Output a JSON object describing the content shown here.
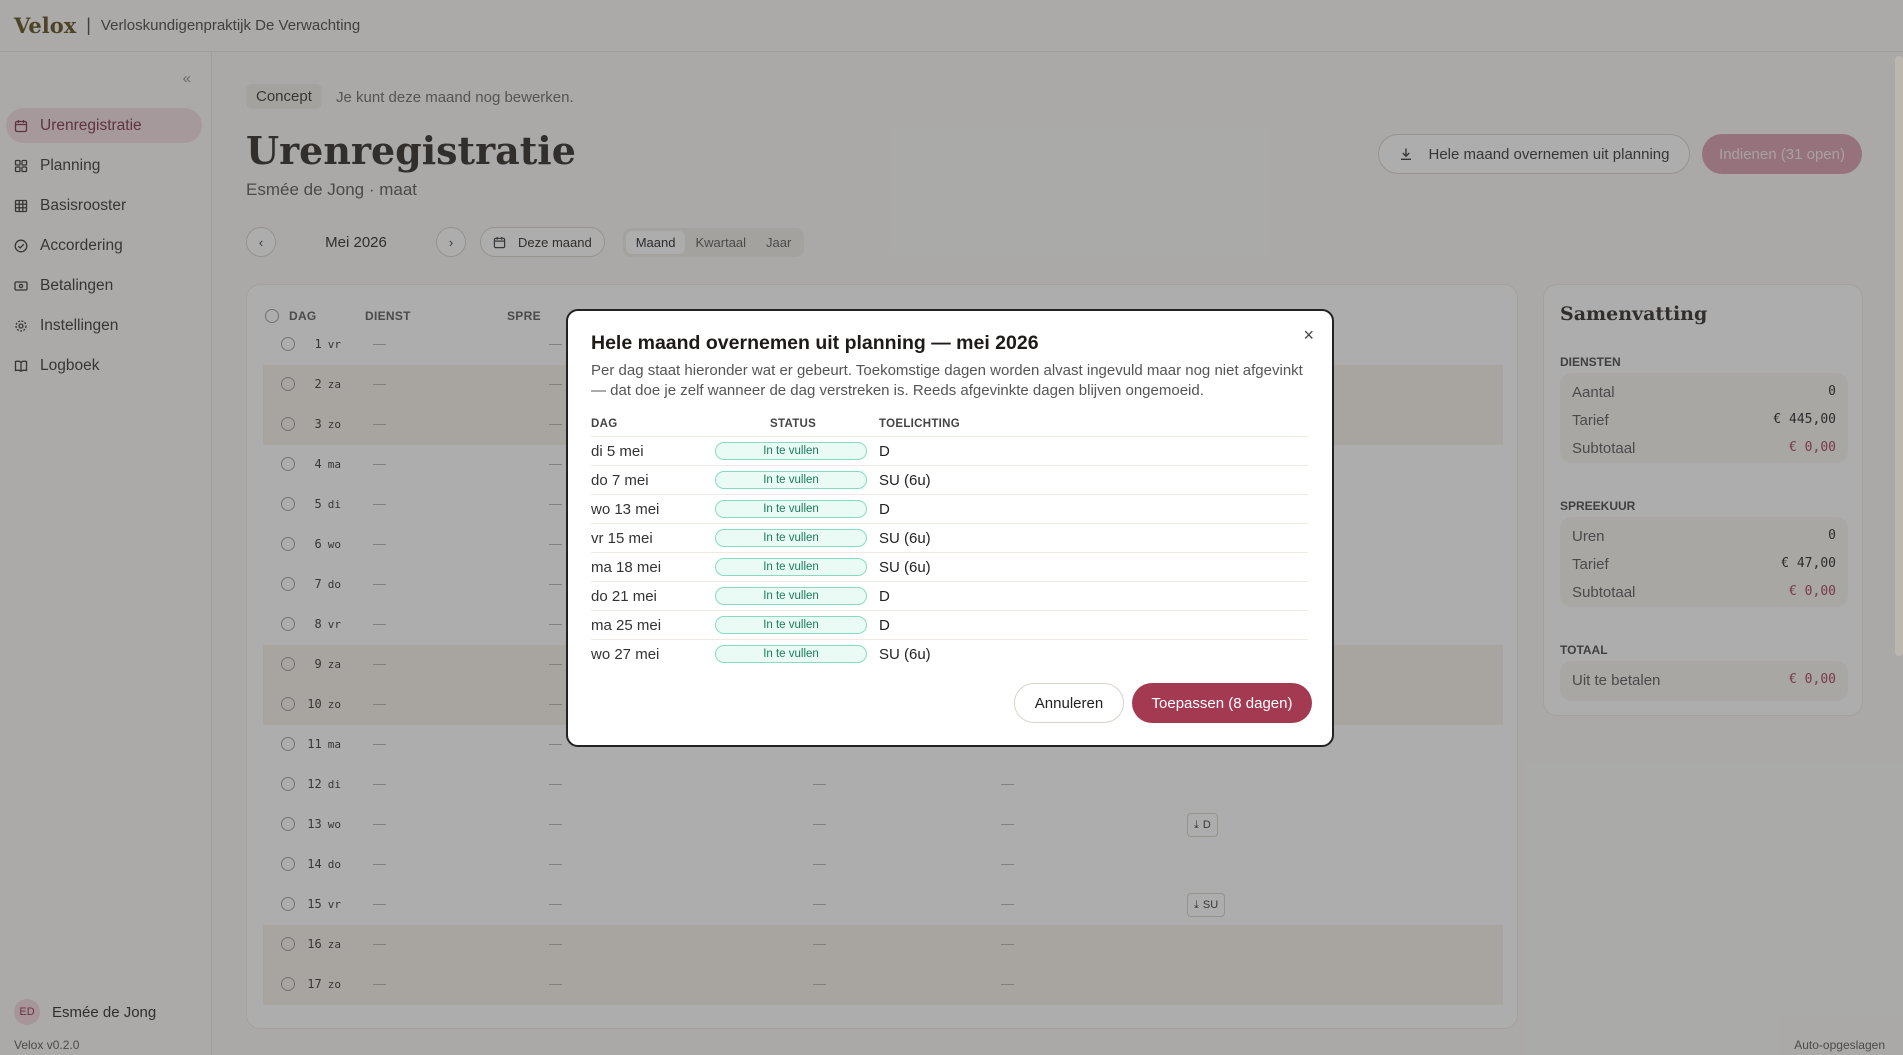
{
  "app": {
    "brand": "Velox",
    "practice": "Verloskundigenpraktijk De Verwachting",
    "version": "Velox v0.2.0",
    "autosave": "Auto-opgeslagen"
  },
  "sidebar": {
    "collapse_icon": "«",
    "items": [
      {
        "label": "Urenregistratie",
        "icon": "calendar-icon",
        "active": true
      },
      {
        "label": "Planning",
        "icon": "grid-icon"
      },
      {
        "label": "Basisrooster",
        "icon": "table-icon"
      },
      {
        "label": "Accordering",
        "icon": "check-circle-icon"
      },
      {
        "label": "Betalingen",
        "icon": "payment-icon"
      },
      {
        "label": "Instellingen",
        "icon": "gear-icon"
      },
      {
        "label": "Logboek",
        "icon": "book-icon"
      }
    ],
    "user": {
      "initials": "ED",
      "name": "Esmée de Jong"
    }
  },
  "main": {
    "status_badge": "Concept",
    "status_text": "Je kunt deze maand nog bewerken.",
    "title": "Urenregistratie",
    "subtitle": "Esmée de Jong · maat",
    "btn_plan": "Hele maand overnemen uit planning",
    "btn_submit": "Indienen (31 open)",
    "period": {
      "month": "Mei 2026",
      "today": "Deze maand",
      "segments": [
        "Maand",
        "Kwartaal",
        "Jaar"
      ],
      "active_segment": "Maand"
    },
    "table": {
      "headers": {
        "day": "DAG",
        "service": "DIENST",
        "consult": "SPRE"
      },
      "rows": [
        {
          "num": "1",
          "wd": "vr",
          "weekend": false
        },
        {
          "num": "2",
          "wd": "za",
          "weekend": true
        },
        {
          "num": "3",
          "wd": "zo",
          "weekend": true
        },
        {
          "num": "4",
          "wd": "ma",
          "weekend": false
        },
        {
          "num": "5",
          "wd": "di",
          "weekend": false
        },
        {
          "num": "6",
          "wd": "wo",
          "weekend": false
        },
        {
          "num": "7",
          "wd": "do",
          "weekend": false
        },
        {
          "num": "8",
          "wd": "vr",
          "weekend": false
        },
        {
          "num": "9",
          "wd": "za",
          "weekend": true
        },
        {
          "num": "10",
          "wd": "zo",
          "weekend": true
        },
        {
          "num": "11",
          "wd": "ma",
          "weekend": false
        },
        {
          "num": "12",
          "wd": "di",
          "weekend": false
        },
        {
          "num": "13",
          "wd": "wo",
          "weekend": false,
          "chip": "D"
        },
        {
          "num": "14",
          "wd": "do",
          "weekend": false
        },
        {
          "num": "15",
          "wd": "vr",
          "weekend": false,
          "chip": "SU"
        },
        {
          "num": "16",
          "wd": "za",
          "weekend": true
        },
        {
          "num": "17",
          "wd": "zo",
          "weekend": true
        }
      ],
      "dash": "—"
    }
  },
  "summary": {
    "title": "Samenvatting",
    "diensten": {
      "header": "DIENSTEN",
      "rows": [
        {
          "label": "Aantal",
          "value": "0",
          "red": false
        },
        {
          "label": "Tarief",
          "value": "€ 445,00",
          "red": false
        },
        {
          "label": "Subtotaal",
          "value": "€ 0,00",
          "red": true
        }
      ]
    },
    "spreekuur": {
      "header": "SPREEKUUR",
      "rows": [
        {
          "label": "Uren",
          "value": "0",
          "red": false
        },
        {
          "label": "Tarief",
          "value": "€ 47,00",
          "red": false
        },
        {
          "label": "Subtotaal",
          "value": "€ 0,00",
          "red": true
        }
      ]
    },
    "totaal": {
      "header": "TOTAAL",
      "rows": [
        {
          "label": "Uit te betalen",
          "value": "€ 0,00",
          "red": true
        }
      ]
    }
  },
  "modal": {
    "title": "Hele maand overnemen uit planning — mei 2026",
    "description": "Per dag staat hieronder wat er gebeurt. Toekomstige dagen worden alvast ingevuld maar nog niet afgevinkt — dat doe je zelf wanneer de dag verstreken is. Reeds afgevinkte dagen blijven ongemoeid.",
    "headers": {
      "day": "DAG",
      "status": "STATUS",
      "note": "TOELICHTING"
    },
    "rows": [
      {
        "day": "di 5 mei",
        "status": "In te vullen",
        "note": "D"
      },
      {
        "day": "do 7 mei",
        "status": "In te vullen",
        "note": "SU (6u)"
      },
      {
        "day": "wo 13 mei",
        "status": "In te vullen",
        "note": "D"
      },
      {
        "day": "vr 15 mei",
        "status": "In te vullen",
        "note": "SU (6u)"
      },
      {
        "day": "ma 18 mei",
        "status": "In te vullen",
        "note": "SU (6u)"
      },
      {
        "day": "do 21 mei",
        "status": "In te vullen",
        "note": "D"
      },
      {
        "day": "ma 25 mei",
        "status": "In te vullen",
        "note": "D"
      },
      {
        "day": "wo 27 mei",
        "status": "In te vullen",
        "note": "SU (6u)"
      }
    ],
    "cancel": "Annuleren",
    "apply": "Toepassen (8 dagen)",
    "close_icon": "×"
  },
  "colors": {
    "accent": "#a33a52",
    "active_nav_bg": "#f2dde2",
    "status_badge_bg": "#e9fbf4",
    "status_badge_border": "#86dcc0"
  }
}
